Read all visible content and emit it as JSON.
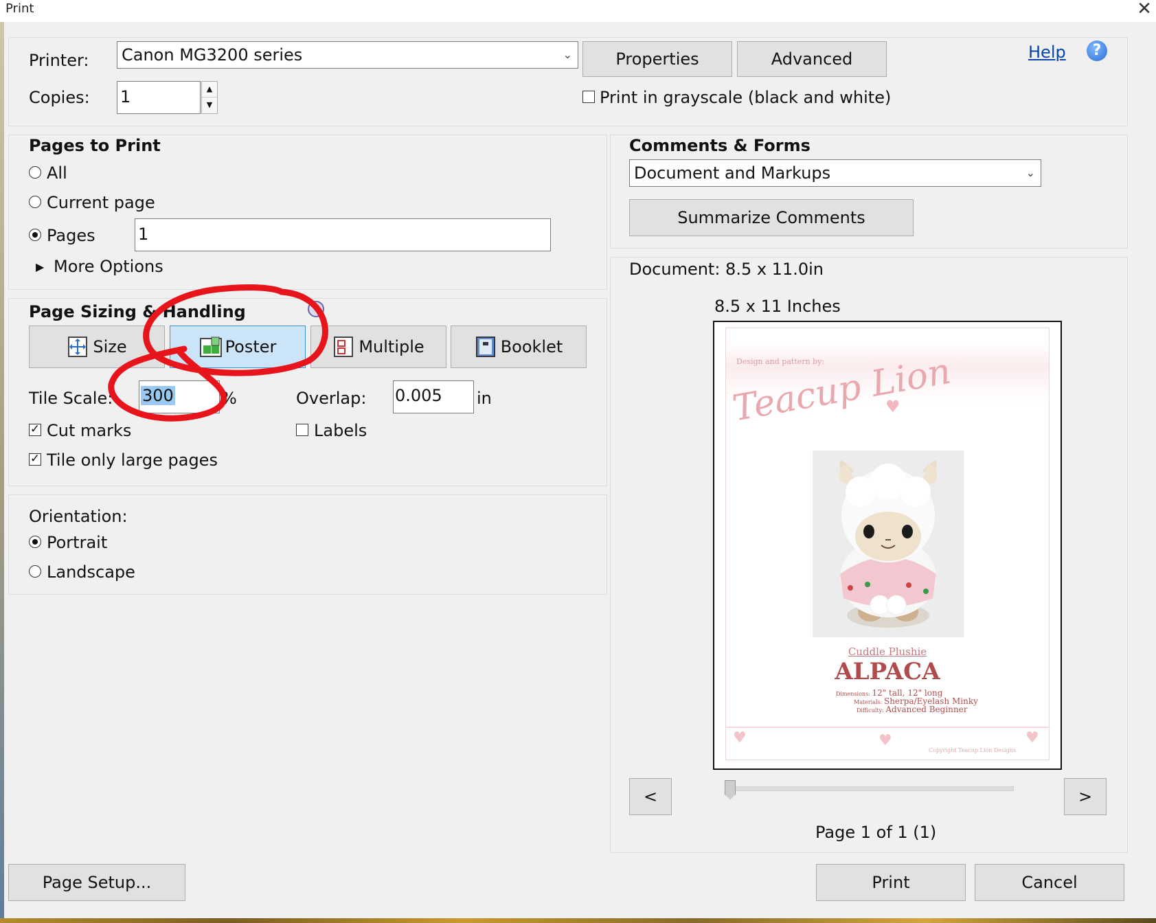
{
  "window": {
    "title": "Print",
    "close_glyph": "✕"
  },
  "printer": {
    "label": "Printer:",
    "selected": "Canon MG3200 series",
    "properties_label": "Properties",
    "advanced_label": "Advanced",
    "help_label": "Help",
    "help_glyph": "?"
  },
  "copies": {
    "label": "Copies:",
    "value": "1"
  },
  "grayscale": {
    "label": "Print in grayscale (black and white)",
    "checked": false
  },
  "pages_to_print": {
    "header": "Pages to Print",
    "all_label": "All",
    "current_label": "Current page",
    "pages_label": "Pages",
    "pages_value": "1",
    "selected": "pages",
    "more_options_label": "More Options"
  },
  "sizing": {
    "header": "Page Sizing & Handling",
    "buttons": [
      {
        "label": "Size",
        "icon": "size-icon"
      },
      {
        "label": "Poster",
        "icon": "poster-icon",
        "selected": true
      },
      {
        "label": "Multiple",
        "icon": "multiple-icon"
      },
      {
        "label": "Booklet",
        "icon": "booklet-icon"
      }
    ],
    "tile_scale_label": "Tile Scale:",
    "tile_scale_value": "300",
    "tile_scale_unit": "%",
    "overlap_label": "Overlap:",
    "overlap_value": "0.005",
    "overlap_unit": "in",
    "cut_marks_label": "Cut marks",
    "cut_marks_checked": true,
    "labels_label": "Labels",
    "labels_checked": false,
    "tile_large_label": "Tile only large pages",
    "tile_large_checked": true
  },
  "orientation": {
    "header": "Orientation:",
    "portrait_label": "Portrait",
    "landscape_label": "Landscape",
    "selected": "portrait"
  },
  "comments_forms": {
    "header": "Comments & Forms",
    "selected": "Document and Markups",
    "summarize_label": "Summarize Comments"
  },
  "preview": {
    "document_label": "Document: 8.5 x 11.0in",
    "size_label": "8.5 x 11 Inches",
    "page_status": "Page 1 of 1 (1)",
    "prev_label": "<",
    "next_label": ">",
    "page_content": {
      "design_by": "Design and pattern by:",
      "brand": "Teacup Lion",
      "subtitle": "Cuddle Plushie",
      "title": "ALPACA",
      "dimensions_label": "Dimensions:",
      "dimensions_value": "12\" tall, 12\" long",
      "materials_label": "Materials:",
      "materials_value": "Sherpa/Eyelash Minky",
      "difficulty_label": "Difficulty:",
      "difficulty_value": "Advanced Beginner",
      "copyright": "Copyright Teacup Lion Designs"
    }
  },
  "footer": {
    "page_setup_label": "Page Setup...",
    "print_label": "Print",
    "cancel_label": "Cancel"
  },
  "colors": {
    "annotation_red": "#e8141c",
    "selected_tab": "#cce4f7",
    "brand_pink": "#e9a7ae",
    "title_red": "#b14b4b"
  }
}
